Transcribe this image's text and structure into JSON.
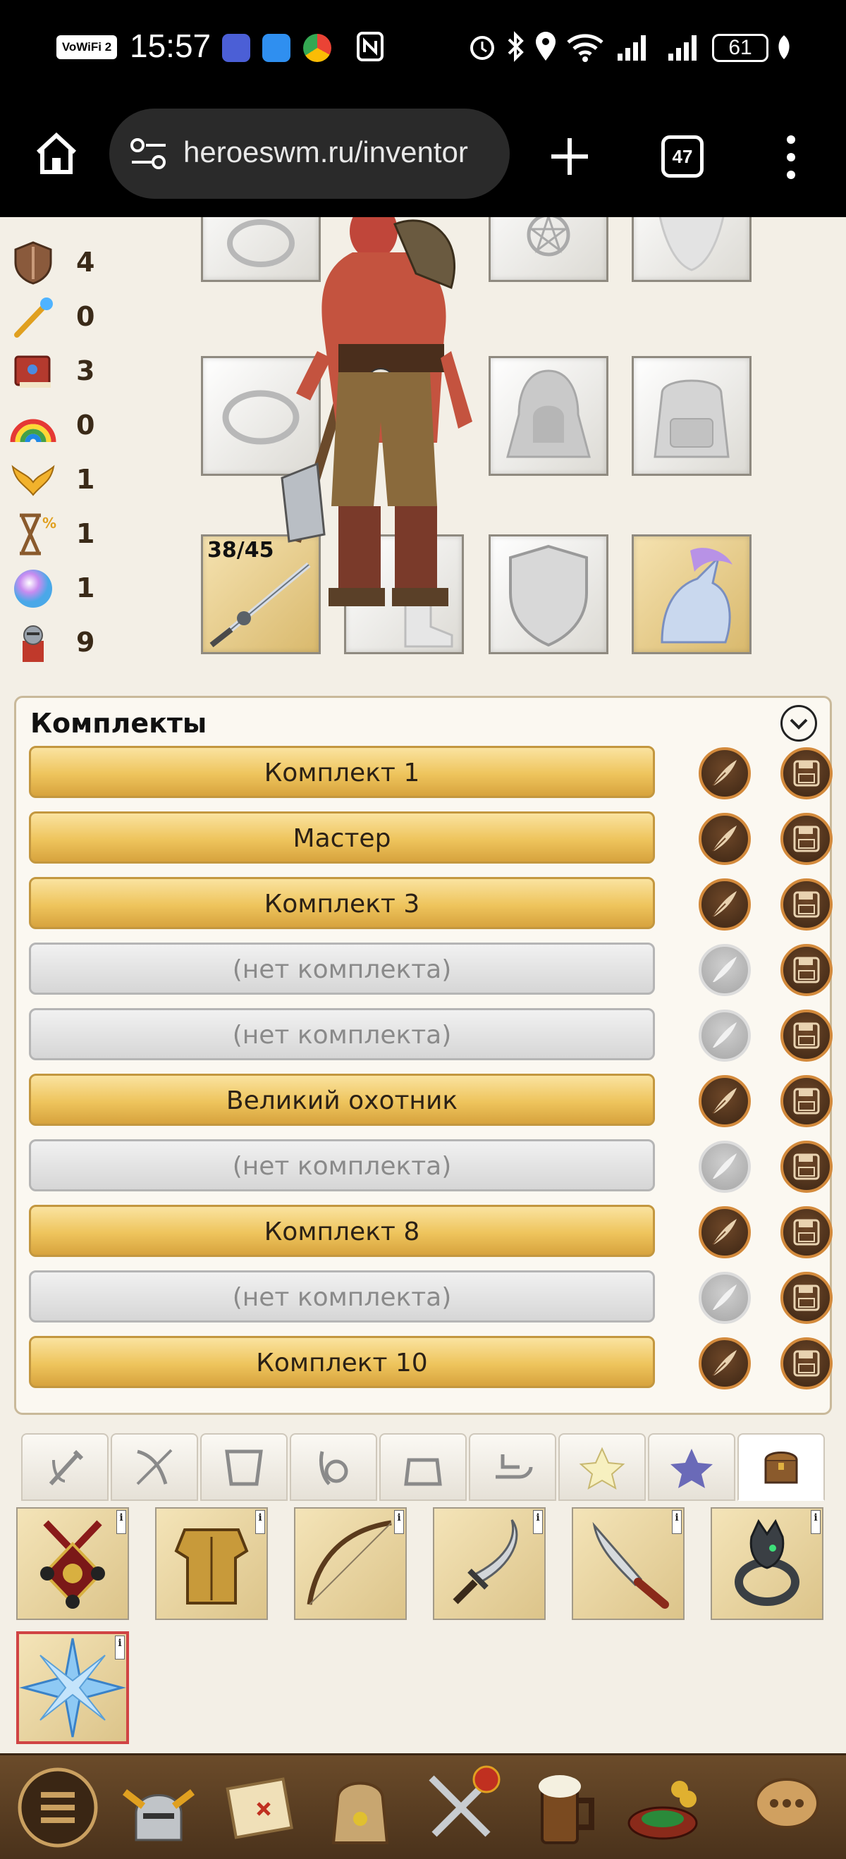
{
  "status_bar": {
    "time": "15:57",
    "network_badge": "VoWiFi 2",
    "battery": "61"
  },
  "browser": {
    "url": "heroeswm.ru/inventor",
    "tab_count": "47"
  },
  "stats": [
    {
      "icon": "defense-shield-icon",
      "value": "4"
    },
    {
      "icon": "magic-staff-icon",
      "value": "0"
    },
    {
      "icon": "spellbook-icon",
      "value": "3"
    },
    {
      "icon": "rainbow-icon",
      "value": "0"
    },
    {
      "icon": "golden-wings-icon",
      "value": "1"
    },
    {
      "icon": "hourglass-percent-icon",
      "value": "1"
    },
    {
      "icon": "crystal-orb-icon",
      "value": "1"
    },
    {
      "icon": "knight-army-icon",
      "value": "9"
    }
  ],
  "equipment": {
    "weapon_durability": "38/45"
  },
  "sets": {
    "title": "Комплекты",
    "items": [
      {
        "label": "Комплект 1",
        "active": true
      },
      {
        "label": "Мастер",
        "active": true
      },
      {
        "label": "Комплект 3",
        "active": true
      },
      {
        "label": "(нет комплекта)",
        "active": false
      },
      {
        "label": "(нет комплекта)",
        "active": false
      },
      {
        "label": "Великий охотник",
        "active": true
      },
      {
        "label": "(нет комплекта)",
        "active": false
      },
      {
        "label": "Комплект 8",
        "active": true
      },
      {
        "label": "(нет комплекта)",
        "active": false
      },
      {
        "label": "Комплект 10",
        "active": true
      }
    ]
  },
  "filter_tabs": [
    "weapons-filter-icon",
    "ranged-filter-icon",
    "armor-filter-icon",
    "rings-filter-icon",
    "bag-filter-icon",
    "hand-filter-icon",
    "star-filter-icon",
    "purple-star-filter-icon",
    "chest-filter-icon"
  ],
  "inventory_items": [
    "medal-amulet-icon",
    "gold-armor-icon",
    "bow-icon",
    "curved-dagger-icon",
    "knife-icon",
    "wolf-ring-icon",
    "ice-crystal-icon"
  ],
  "bottom_nav": [
    "menu-icon",
    "knight-helmet-icon",
    "map-scroll-icon",
    "backpack-icon",
    "crossed-swords-icon",
    "tavern-mug-icon",
    "roulette-icon",
    "chat-bubbles-icon"
  ],
  "colors": {
    "gold_button": "#eec45c",
    "disabled_button": "#d6d6d6",
    "panel_border": "#c9b99a",
    "nav_bg": "#5a3d21"
  }
}
